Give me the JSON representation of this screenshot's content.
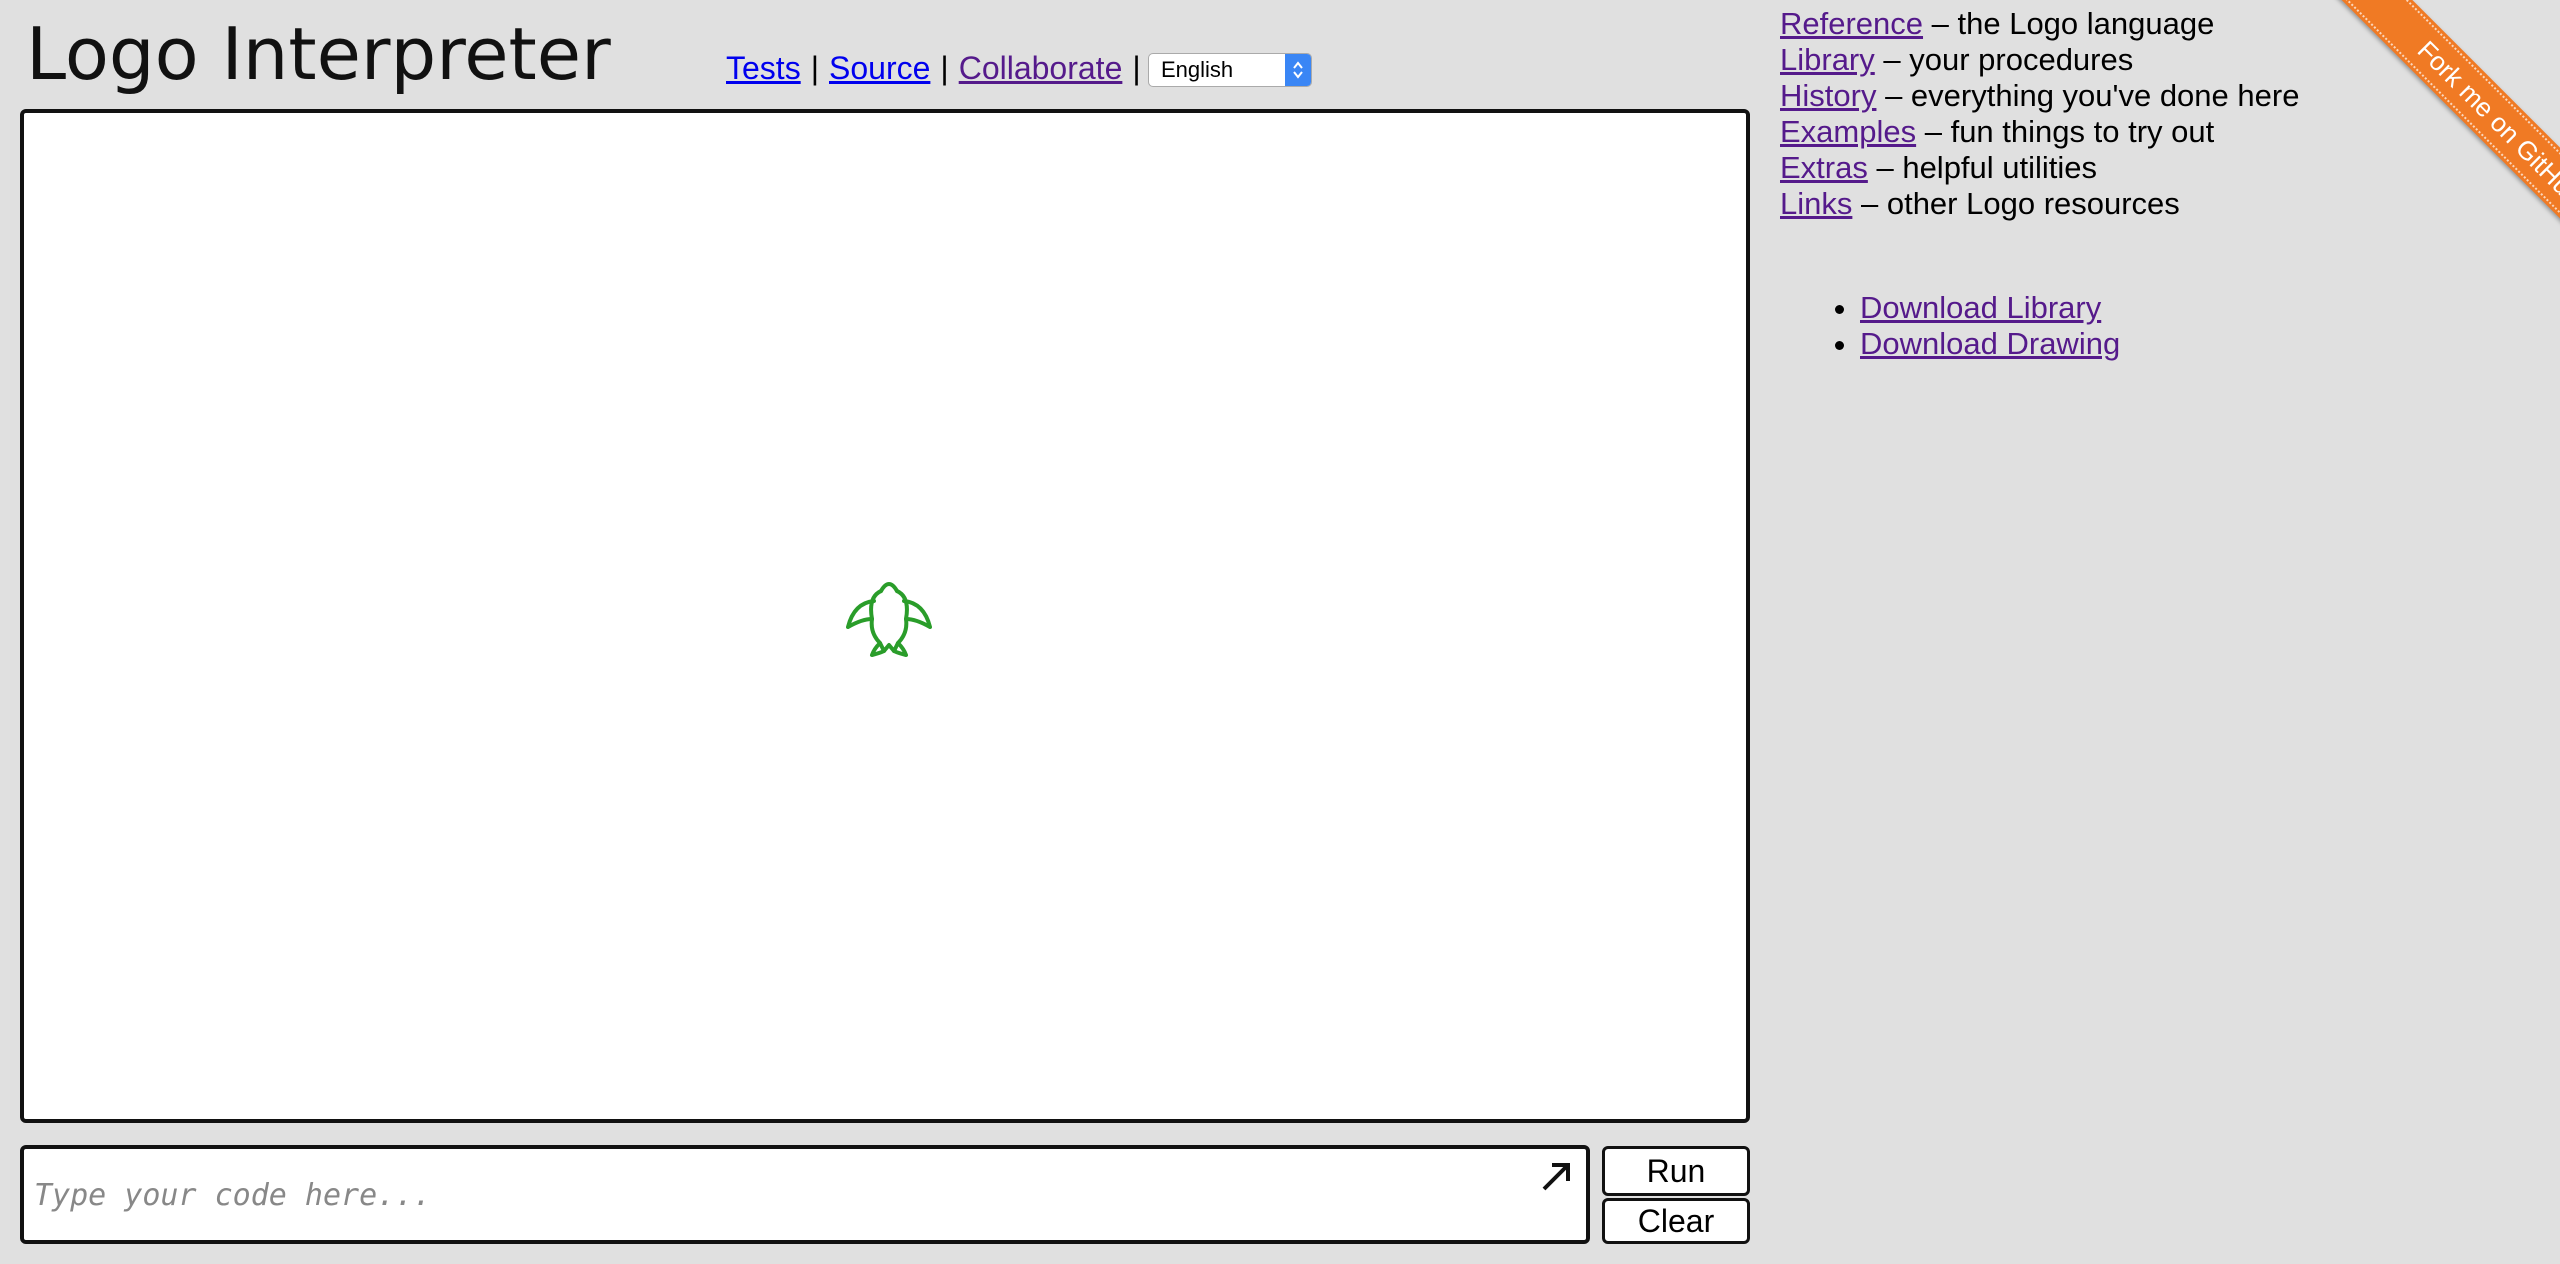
{
  "header": {
    "title": "Logo Interpreter",
    "nav": [
      {
        "label": "Tests"
      },
      {
        "label": "Source"
      },
      {
        "label": "Collaborate"
      }
    ],
    "separator": "|",
    "language": {
      "selected": "English"
    }
  },
  "canvas": {
    "turtle": {
      "icon": "turtle-icon",
      "color": "#2a9d2a"
    }
  },
  "input": {
    "placeholder": "Type your code here...",
    "expand_icon": "expand-arrow-icon"
  },
  "buttons": {
    "run": "Run",
    "clear": "Clear"
  },
  "side_panel": {
    "links": [
      {
        "label": "Reference",
        "desc": " – the Logo language"
      },
      {
        "label": "Library",
        "desc": " – your procedures"
      },
      {
        "label": "History",
        "desc": " – everything you've done here"
      },
      {
        "label": "Examples",
        "desc": " – fun things to try out"
      },
      {
        "label": "Extras",
        "desc": " – helpful utilities"
      },
      {
        "label": "Links",
        "desc": " – other Logo resources"
      }
    ],
    "downloads": [
      {
        "label": "Download Library"
      },
      {
        "label": "Download Drawing"
      }
    ]
  },
  "ribbon": {
    "label": "Fork me on GitHub",
    "color": "#f07a24"
  }
}
